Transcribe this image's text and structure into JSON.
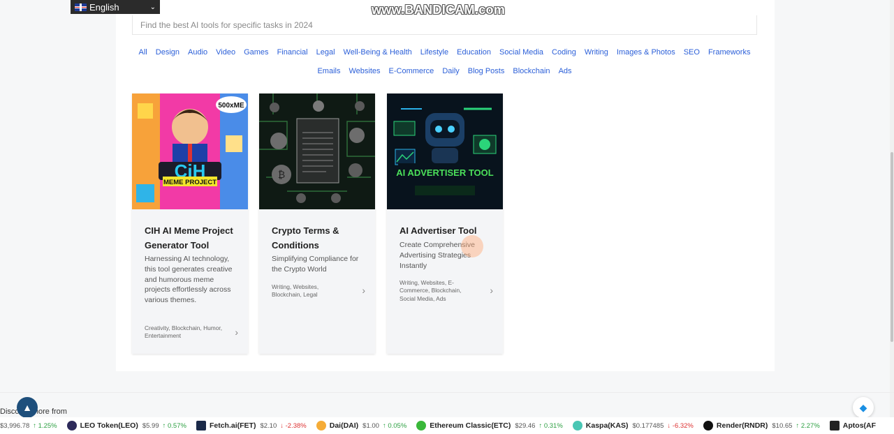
{
  "language": {
    "label": "English"
  },
  "watermark": "www.BANDICAM.com",
  "search": {
    "placeholder": "Find the best AI tools for specific tasks in 2024"
  },
  "categories_row1": [
    "All",
    "Design",
    "Audio",
    "Video",
    "Games",
    "Financial",
    "Legal",
    "Well-Being & Health",
    "Lifestyle",
    "Education",
    "Social Media",
    "Coding",
    "Writing",
    "Images & Photos",
    "SEO",
    "Frameworks"
  ],
  "categories_row2": [
    "Emails",
    "Websites",
    "E-Commerce",
    "Daily",
    "Blog Posts",
    "Blockchain",
    "Ads"
  ],
  "cards": [
    {
      "title": "CIH AI Meme Project Generator Tool",
      "desc": "Harnessing AI technology, this tool generates creative and humorous meme projects effortlessly across various themes.",
      "tags": "Creativity, Blockchain, Humor, Entertainment",
      "thumb_text": "CiH",
      "thumb_sub": "MEME PROJECT",
      "thumb_badge": "500xME"
    },
    {
      "title": "Crypto Terms & Conditions",
      "desc": "Simplifying Compliance for the Crypto World",
      "tags": "Writing, Websites, Blockchain, Legal"
    },
    {
      "title": "AI Advertiser Tool",
      "desc": "Create Comprehensive Advertising Strategies Instantly",
      "tags": "Writing, Websites, E-Commerce, Blockchain, Social Media, Ads",
      "thumb_text": "AI ADVERTISER TOOL"
    }
  ],
  "footer": {
    "discover": "Discover more from"
  },
  "ticker": [
    {
      "name": "",
      "price": "$3,996.78",
      "change": "1.25%",
      "dir": "up",
      "color": "#ffffff"
    },
    {
      "name": "LEO Token(LEO)",
      "price": "$5.99",
      "change": "0.57%",
      "dir": "up",
      "color": "#2d2a5a"
    },
    {
      "name": "Fetch.ai(FET)",
      "price": "$2.10",
      "change": "-2.38%",
      "dir": "down",
      "color": "#1b2a49"
    },
    {
      "name": "Dai(DAI)",
      "price": "$1.00",
      "change": "0.05%",
      "dir": "up",
      "color": "#f5ac37"
    },
    {
      "name": "Ethereum Classic(ETC)",
      "price": "$29.46",
      "change": "0.31%",
      "dir": "up",
      "color": "#3ab83a"
    },
    {
      "name": "Kaspa(KAS)",
      "price": "$0.177485",
      "change": "-6.32%",
      "dir": "down",
      "color": "#49c6b4"
    },
    {
      "name": "Render(RNDR)",
      "price": "$10.65",
      "change": "2.27%",
      "dir": "up",
      "color": "#111111"
    },
    {
      "name": "Aptos(AF",
      "price": "",
      "change": "",
      "dir": "up",
      "color": "#222222"
    }
  ]
}
